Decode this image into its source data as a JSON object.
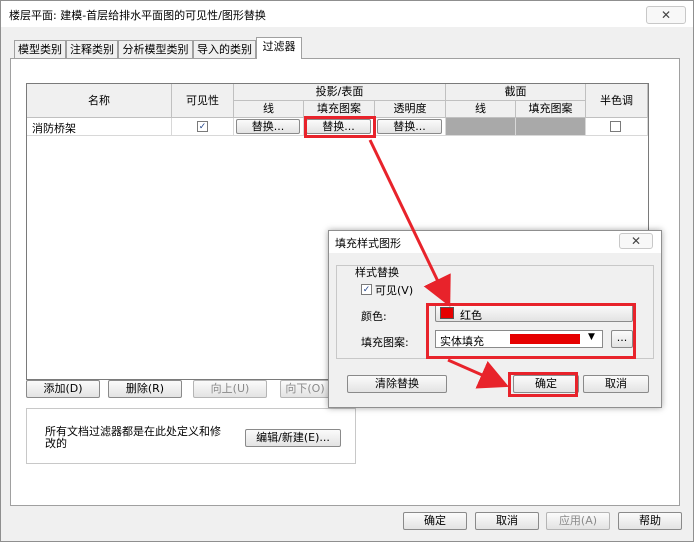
{
  "window": {
    "title": "楼层平面: 建模-首层给排水平面图的可见性/图形替换",
    "close_label": "✕"
  },
  "tabs": [
    {
      "label": "模型类别"
    },
    {
      "label": "注释类别"
    },
    {
      "label": "分析模型类别"
    },
    {
      "label": "导入的类别"
    },
    {
      "label": "过滤器"
    }
  ],
  "grid": {
    "headers": {
      "name": "名称",
      "visibility": "可见性",
      "projection_surface": "投影/表面",
      "cut": "截面",
      "halftone": "半色调",
      "line": "线",
      "fill_pattern": "填充图案",
      "transparency": "透明度",
      "cut_line": "线",
      "cut_fill_pattern": "填充图案"
    },
    "rows": [
      {
        "name": "消防桥架",
        "visible": true,
        "line_btn": "替换...",
        "fill_btn": "替换...",
        "transparency_btn": "替换...",
        "halftone": false
      }
    ]
  },
  "filter_buttons": {
    "add": "添加(D)",
    "delete": "删除(R)",
    "up": "向上(U)",
    "down": "向下(O)"
  },
  "info": {
    "text": "所有文档过滤器都是在此处定义和修改的",
    "edit_button": "编辑/新建(E)..."
  },
  "footer": {
    "ok": "确定",
    "cancel": "取消",
    "apply": "应用(A)",
    "help": "帮助"
  },
  "fill_dialog": {
    "title": "填充样式图形",
    "close_label": "✕",
    "group_label": "样式替换",
    "visible_label": "可见(V)",
    "visible_checked": true,
    "color_label": "颜色:",
    "color_value": "红色",
    "color_hex": "#e60000",
    "pattern_label": "填充图案:",
    "pattern_value": "实体填充",
    "pattern_more": "...",
    "clear_button": "清除替换",
    "ok_button": "确定",
    "cancel_button": "取消"
  },
  "annotation_color": "#e8232b"
}
